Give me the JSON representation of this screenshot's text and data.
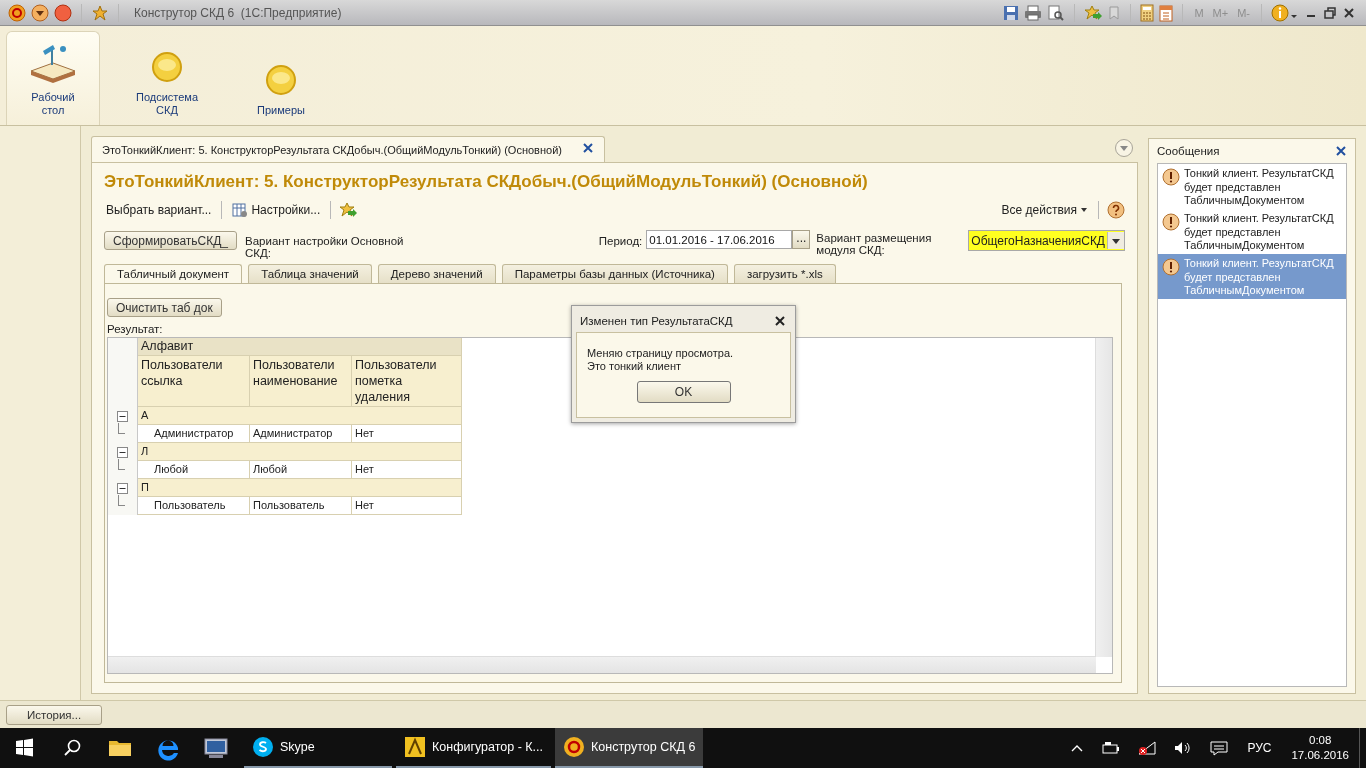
{
  "window": {
    "title": "Конструтор СКД 6  (1С:Предприятие)"
  },
  "memory_buttons": [
    {
      "label": "M",
      "disabled": true
    },
    {
      "label": "M+",
      "disabled": true
    },
    {
      "label": "M-",
      "disabled": true
    }
  ],
  "sections": [
    {
      "label": "Рабочий стол",
      "kind": "desktop",
      "selected": true
    },
    {
      "label": "Подсистема СКД",
      "kind": "subsystem",
      "selected": false
    },
    {
      "label": "Примеры",
      "kind": "subsystem",
      "selected": false
    }
  ],
  "form_tab": {
    "title": "ЭтоТонкийКлиент: 5. КонструкторРезультата СКДобыч.(ОбщийМодульТонкий) (Основной)"
  },
  "form": {
    "heading": "ЭтоТонкийКлиент: 5. КонструкторРезультата СКДобыч.(ОбщийМодульТонкий) (Основной)",
    "toolbar": {
      "choose_variant": "Выбрать вариант...",
      "settings": "Настройки...",
      "all_actions": "Все действия"
    },
    "generate_button": "СформироватьСКД_",
    "variant_label": "Вариант настройки Основной СКД:",
    "period_label": "Период:",
    "period_value": "01.01.2016 - 17.06.2016",
    "period_select": "...",
    "placement_label": "Вариант размещения модуля СКД:",
    "placement_value": "ОбщегоНазначенияСКД",
    "tabs": [
      {
        "label": "Табличный документ",
        "selected": true
      },
      {
        "label": "Таблица значений",
        "selected": false
      },
      {
        "label": "Дерево значений",
        "selected": false
      },
      {
        "label": "Параметры базы данных (Источника)",
        "selected": false
      },
      {
        "label": "загрузить *.xls",
        "selected": false
      }
    ],
    "clear_button": "Очистить таб док",
    "result_label": "Результат:",
    "report": {
      "group_header": "Алфавит",
      "columns": [
        "Пользователи ссылка",
        "Пользователи наименование",
        "Пользователи пометка удаления"
      ],
      "groups": [
        {
          "label": "А",
          "expanded": true,
          "rows": [
            [
              "Администратор",
              "Администратор",
              "Нет"
            ]
          ]
        },
        {
          "label": "Л",
          "expanded": true,
          "rows": [
            [
              "Любой",
              "Любой",
              "Нет"
            ]
          ]
        },
        {
          "label": "П",
          "expanded": true,
          "rows": [
            [
              "Пользователь",
              "Пользователь",
              "Нет"
            ]
          ]
        }
      ]
    }
  },
  "messages": {
    "title": "Сообщения",
    "items": [
      {
        "text": "Тонкий клиент. РезультатСКД будет представлен ТабличнымДокументом",
        "selected": false
      },
      {
        "text": "Тонкий клиент. РезультатСКД будет представлен ТабличнымДокументом",
        "selected": false
      },
      {
        "text": "Тонкий клиент. РезультатСКД будет представлен ТабличнымДокументом",
        "selected": true
      }
    ]
  },
  "dialog": {
    "title": "Изменен тип РезультатаСКД",
    "lines": [
      "Меняю страницу просмотра.",
      "Это тонкий клиент"
    ],
    "button": "OK"
  },
  "history_button": "История...",
  "taskbar": {
    "apps": [
      {
        "label": "Skype",
        "kind": "skype",
        "selected": false
      },
      {
        "label": "Конфигуратор - К...",
        "kind": "configurator",
        "selected": false
      },
      {
        "label": "Конструтор СКД 6",
        "kind": "onec",
        "selected": true
      }
    ],
    "language": "РУС",
    "time": "0:08",
    "date": "17.06.2016"
  }
}
